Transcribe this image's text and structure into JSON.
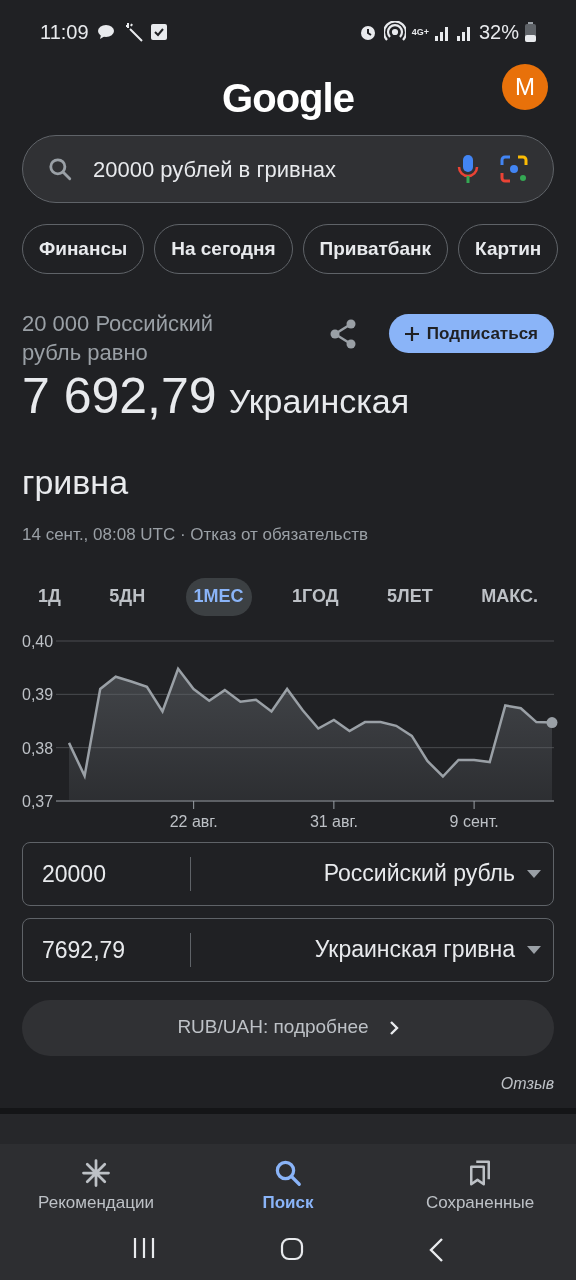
{
  "status_bar": {
    "time": "11:09",
    "network": "4G+",
    "battery": "32%"
  },
  "header": {
    "logo": "Google",
    "avatar": "M"
  },
  "search": {
    "value": "20000 рублей в гривнах"
  },
  "chips": [
    "Финансы",
    "На сегодня",
    "Приватбанк",
    "Картин"
  ],
  "result": {
    "from_text": "20 000 Российский рубль равно",
    "amount": "7 692,79",
    "currency": "Украинская гривна",
    "meta": "14 сент., 08:08 UTC · Отказ от обязательств",
    "subscribe": "Подписаться"
  },
  "ranges": [
    {
      "label": "1Д",
      "selected": false
    },
    {
      "label": "5ДН",
      "selected": false
    },
    {
      "label": "1МЕС",
      "selected": true
    },
    {
      "label": "1ГОД",
      "selected": false
    },
    {
      "label": "5ЛЕТ",
      "selected": false
    },
    {
      "label": "МАКС.",
      "selected": false
    }
  ],
  "chart_data": {
    "type": "area",
    "categories": [
      null,
      null,
      null,
      null,
      null,
      null,
      null,
      null,
      "22 авг.",
      null,
      null,
      null,
      null,
      null,
      null,
      null,
      null,
      "31 авг.",
      null,
      null,
      null,
      null,
      null,
      null,
      null,
      null,
      "9 сент.",
      null,
      null,
      null,
      null,
      null
    ],
    "series": [
      {
        "color": "#9aa0a6",
        "values": [
          0.3809,
          0.3747,
          0.391,
          0.3933,
          0.3924,
          0.3914,
          0.3868,
          0.3948,
          0.391,
          0.3888,
          0.3908,
          0.3886,
          0.389,
          0.3868,
          0.391,
          0.387,
          0.3836,
          0.3852,
          0.3831,
          0.3848,
          0.3848,
          0.3841,
          0.3822,
          0.3775,
          0.3746,
          0.3777,
          0.3777,
          0.3773,
          0.3879,
          0.3874,
          0.3848,
          0.3847
        ]
      }
    ],
    "ylim": [
      0.37,
      0.4
    ],
    "yticks": [
      {
        "value": 0.4,
        "label": "0,40"
      },
      {
        "value": 0.39,
        "label": "0,39"
      },
      {
        "value": 0.38,
        "label": "0,38"
      },
      {
        "value": 0.37,
        "label": "0,37"
      }
    ]
  },
  "converter": [
    {
      "value": "20000",
      "currency": "Российский рубль"
    },
    {
      "value": "7692,79",
      "currency": "Украинская гривна"
    }
  ],
  "details_button": "RUB/UAH: подробнее",
  "feedback": "Отзыв",
  "bottom_nav": [
    {
      "label": "Рекомендации",
      "selected": false
    },
    {
      "label": "Поиск",
      "selected": true
    },
    {
      "label": "Сохраненные",
      "selected": false
    }
  ]
}
